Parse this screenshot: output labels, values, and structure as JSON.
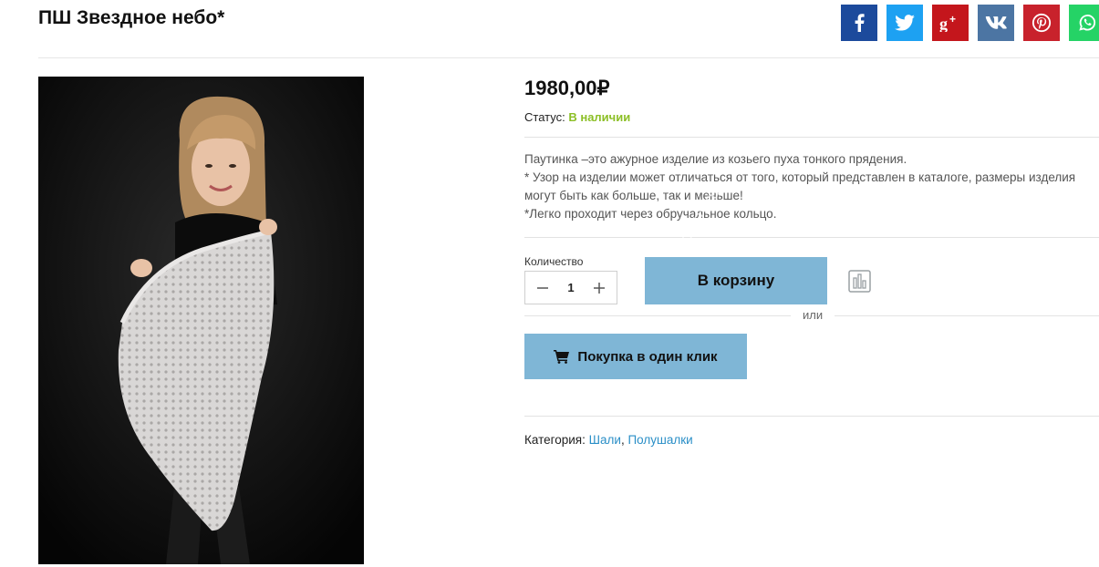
{
  "product": {
    "title": "ПШ Звездное небо*",
    "price": "1980,00₽",
    "status_label": "Статус:",
    "status_value": "В наличии",
    "description": [
      "Паутинка –это ажурное изделие из козьего пуха тонкого прядения.",
      "* Узор на изделии может отличаться от того, который представлен в каталоге, размеры изделия могут быть как больше, так и меньше!",
      "*Легко проходит через обручальное кольцо."
    ],
    "quantity_label": "Количество",
    "quantity_value": "1",
    "cart_button": "В корзину",
    "watermark": "darov.ru",
    "or_text": "или",
    "oneclick_button": "Покупка в один клик",
    "category_label": "Категория:",
    "categories": [
      "Шали",
      "Полушалки"
    ]
  },
  "share": [
    "facebook-icon",
    "twitter-icon",
    "google-plus-icon",
    "vk-icon",
    "pinterest-icon",
    "whatsapp-icon"
  ],
  "colors": {
    "accent_button": "#7fb6d6",
    "status_green": "#8cbf26",
    "link_blue": "#2b8fc7",
    "facebook": "#1c4a9c",
    "twitter": "#1da1f2",
    "google_plus": "#c4161c",
    "vk": "#4c75a3",
    "pinterest": "#c8222c",
    "whatsapp": "#25d366"
  }
}
